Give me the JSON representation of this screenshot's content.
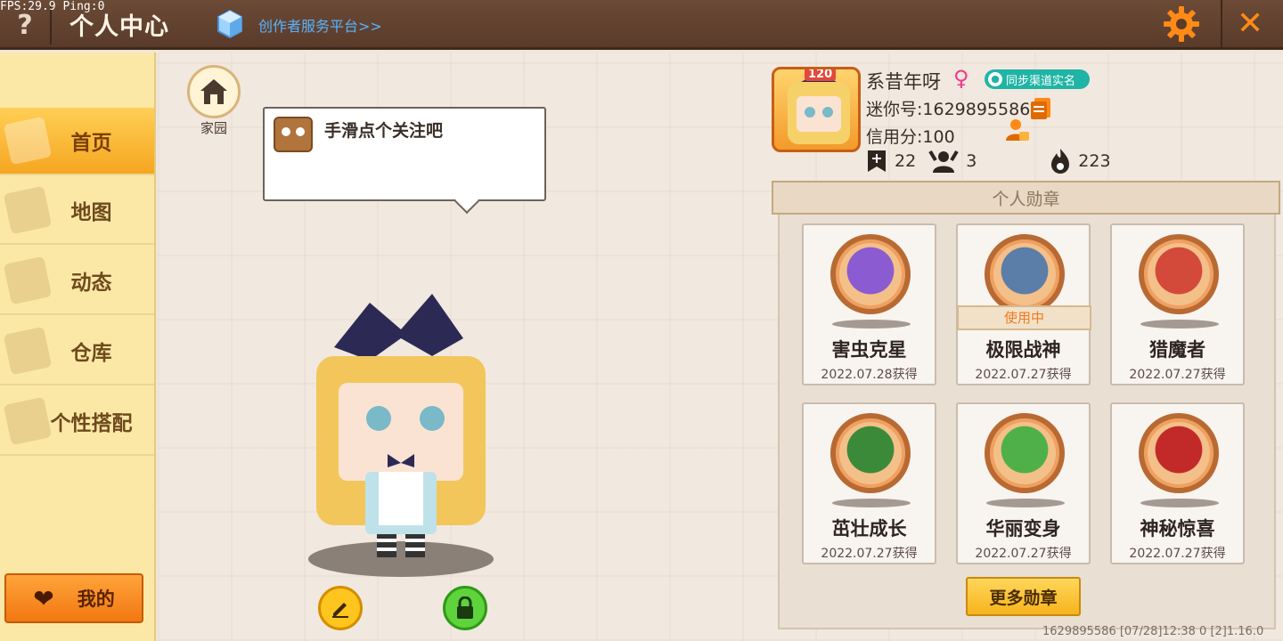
{
  "debug": {
    "fps": "FPS:29.9  Ping:0"
  },
  "header": {
    "help": "?",
    "title": "个人中心",
    "creator_link": "创作者服务平台>>",
    "close": "✕"
  },
  "sidebar": {
    "items": [
      {
        "label": "首页",
        "icon": "house-icon",
        "active": true
      },
      {
        "label": "地图",
        "icon": "map-icon",
        "active": false
      },
      {
        "label": "动态",
        "icon": "bell-icon",
        "active": false
      },
      {
        "label": "仓库",
        "icon": "box-icon",
        "active": false
      },
      {
        "label": "个性搭配",
        "icon": "outfit-icon",
        "active": false
      }
    ],
    "mine_label": "我的"
  },
  "home": {
    "label": "家园"
  },
  "bubble": {
    "text": "手滑点个关注吧"
  },
  "profile": {
    "level": "120",
    "nickname": "系昔年呀",
    "gender_icon": "female-icon",
    "sync_label": "同步渠道实名",
    "mini_id": "迷你号:1629895586",
    "credit": "信用分:100",
    "stats": {
      "posts": "22",
      "followers": "3",
      "heat": "223"
    }
  },
  "badges": {
    "header": "个人勋章",
    "items": [
      {
        "name": "害虫克星",
        "date": "2022.07.28获得",
        "in_use": false,
        "color": "#8a5bd1"
      },
      {
        "name": "极限战神",
        "date": "2022.07.27获得",
        "in_use": true,
        "in_use_label": "使用中",
        "color": "#5a7ea8"
      },
      {
        "name": "猎魔者",
        "date": "2022.07.27获得",
        "in_use": false,
        "color": "#d34a3a"
      },
      {
        "name": "茁壮成长",
        "date": "2022.07.27获得",
        "in_use": false,
        "color": "#3b8a3a"
      },
      {
        "name": "华丽变身",
        "date": "2022.07.27获得",
        "in_use": false,
        "color": "#4fb04a"
      },
      {
        "name": "神秘惊喜",
        "date": "2022.07.27获得",
        "in_use": false,
        "color": "#c22a2a"
      }
    ],
    "more_label": "更多勋章"
  },
  "footer": {
    "info": "1629895586   [07/28]12:38 0   [2]1.16.0"
  }
}
